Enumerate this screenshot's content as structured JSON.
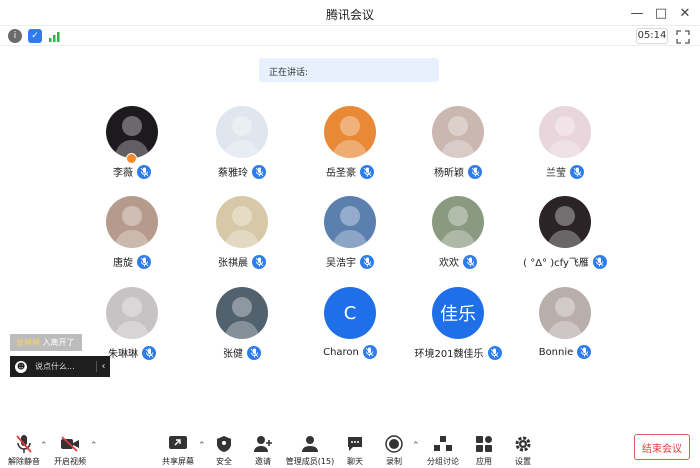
{
  "window": {
    "title": "腾讯会议"
  },
  "status": {
    "timer": "05:14"
  },
  "speaking": {
    "label": "正在讲话:"
  },
  "participants": [
    {
      "name": "李薇",
      "avatar_color": "#1d1a1e",
      "host": true
    },
    {
      "name": "蔡雅玲",
      "avatar_color": "#dfe6ee"
    },
    {
      "name": "岳圣豪",
      "avatar_color": "#e98936"
    },
    {
      "name": "杨昕颖",
      "avatar_color": "#c9b7b0"
    },
    {
      "name": "兰莹",
      "avatar_color": "#e9d6dc"
    },
    {
      "name": "唐旋",
      "avatar_color": "#b69b8c"
    },
    {
      "name": "张祺晨",
      "avatar_color": "#d7c9a8"
    },
    {
      "name": "吴浩宇",
      "avatar_color": "#5b7fae"
    },
    {
      "name": "欢欢",
      "avatar_color": "#8a9a80"
    },
    {
      "name": "( °Δ° )cfy飞雁",
      "avatar_color": "#2a2426"
    },
    {
      "name": "朱琳琳",
      "avatar_color": "#c7c2c4"
    },
    {
      "name": "张健",
      "avatar_color": "#52616e"
    },
    {
      "name": "Charon",
      "avatar_color": "#1e6fe8",
      "letter": "C"
    },
    {
      "name": "环境201魏佳乐",
      "avatar_color": "#1e6fe8",
      "letter": "佳乐"
    },
    {
      "name": "Bonnie",
      "avatar_color": "#b8aeab"
    }
  ],
  "chat": {
    "notify_name": "张琳琳",
    "notify_text": "入离开了",
    "placeholder": "说点什么..."
  },
  "toolbar": {
    "unmute": "解除静音",
    "video": "开启视频",
    "share": "共享屏幕",
    "security": "安全",
    "invite": "邀请",
    "members": "管理成员(15)",
    "chat": "聊天",
    "record": "录制",
    "breakout": "分组讨论",
    "apps": "应用",
    "settings": "设置",
    "end": "结束会议"
  },
  "colors": {
    "accent": "#2f7ded",
    "end": "#e23b3b"
  }
}
